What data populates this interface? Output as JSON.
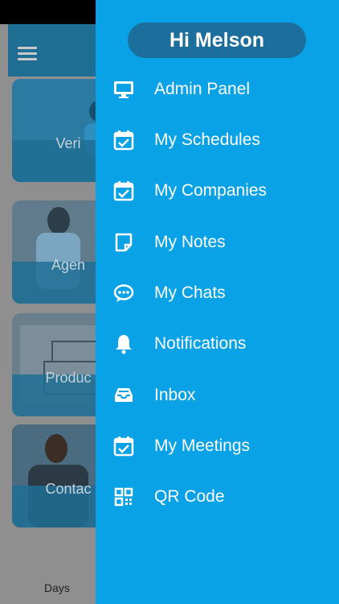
{
  "background": {
    "cards": [
      {
        "label": "Veri"
      },
      {
        "label": "Agen"
      },
      {
        "label": "Produc"
      },
      {
        "label": "Contac"
      }
    ],
    "bottom_tab_label": "Days"
  },
  "drawer": {
    "greeting": "Hi Melson",
    "items": [
      {
        "label": "Admin Panel",
        "icon": "monitor-icon"
      },
      {
        "label": "My Schedules",
        "icon": "calendar-check-icon"
      },
      {
        "label": "My Companies",
        "icon": "calendar-check-icon"
      },
      {
        "label": "My Notes",
        "icon": "note-icon"
      },
      {
        "label": "My Chats",
        "icon": "chat-bubble-icon"
      },
      {
        "label": "Notifications",
        "icon": "bell-icon"
      },
      {
        "label": "Inbox",
        "icon": "inbox-icon"
      },
      {
        "label": "My Meetings",
        "icon": "calendar-check-icon"
      },
      {
        "label": "QR Code",
        "icon": "qr-code-icon"
      }
    ],
    "colors": {
      "drawer_bg": "#09a2e6",
      "greeting_bg": "#1c6e9c",
      "text": "#ffffff"
    }
  }
}
